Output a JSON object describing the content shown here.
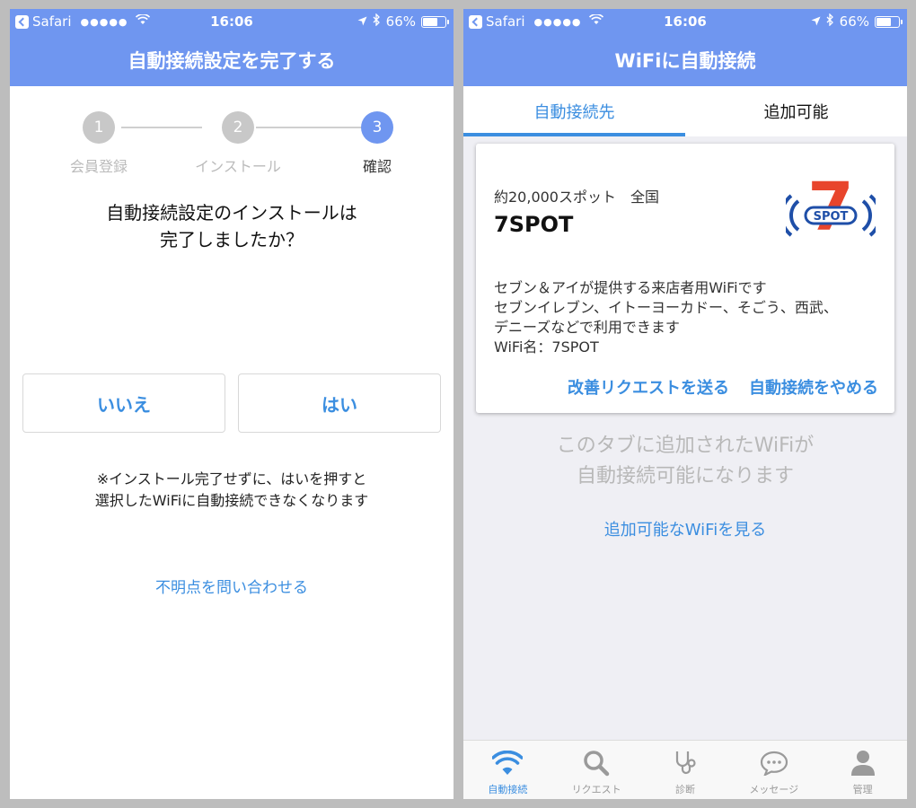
{
  "status_bar": {
    "carrier": "Safari",
    "signal": "●●●●●",
    "time": "16:06",
    "battery": "66%",
    "battery_fraction": 0.66
  },
  "left": {
    "title": "自動接続設定を完了する",
    "steps": [
      {
        "number": "1",
        "label": "会員登録",
        "state": "done"
      },
      {
        "number": "2",
        "label": "インストール",
        "state": "done"
      },
      {
        "number": "3",
        "label": "確認",
        "state": "active"
      }
    ],
    "question_line1": "自動接続設定のインストールは",
    "question_line2": "完了しましたか？",
    "no_button": "いいえ",
    "yes_button": "はい",
    "note_line1": "※インストール完了せずに、はいを押すと",
    "note_line2": "選択したWiFiに自動接続できなくなります",
    "contact_link": "不明点を問い合わせる"
  },
  "right": {
    "title": "WiFiに自動接続",
    "tabs": [
      {
        "label": "自動接続先",
        "active": true
      },
      {
        "label": "追加可能",
        "active": false
      }
    ],
    "card": {
      "count": "約20,000スポット　全国",
      "name": "7SPOT",
      "logo_text": "SPOT",
      "logo_numeral": "7",
      "desc_lines": [
        "セブン＆アイが提供する来店者用WiFiです",
        "セブンイレブン、イトーヨーカドー、そごう、西武、",
        "デニーズなどで利用できます",
        "WiFi名：7SPOT"
      ],
      "request_button": "改善リクエストを送る",
      "stop_button": "自動接続をやめる"
    },
    "empty_line1": "このタブに追加されたWiFiが",
    "empty_line2": "自動接続可能になります",
    "add_link": "追加可能なWiFiを見る",
    "tabbar": [
      {
        "label": "自動接続",
        "icon": "wifi-icon",
        "active": true
      },
      {
        "label": "リクエスト",
        "icon": "search-icon",
        "active": false
      },
      {
        "label": "診断",
        "icon": "stethoscope-icon",
        "active": false
      },
      {
        "label": "メッセージ",
        "icon": "chat-bubble-icon",
        "active": false
      },
      {
        "label": "管理",
        "icon": "person-icon",
        "active": false
      }
    ]
  },
  "colors": {
    "header": "#6f96f0",
    "link": "#3b8ee0",
    "inactive_step": "#c8c8c8",
    "logo_red": "#e8452c",
    "logo_blue": "#1f4fa8"
  }
}
